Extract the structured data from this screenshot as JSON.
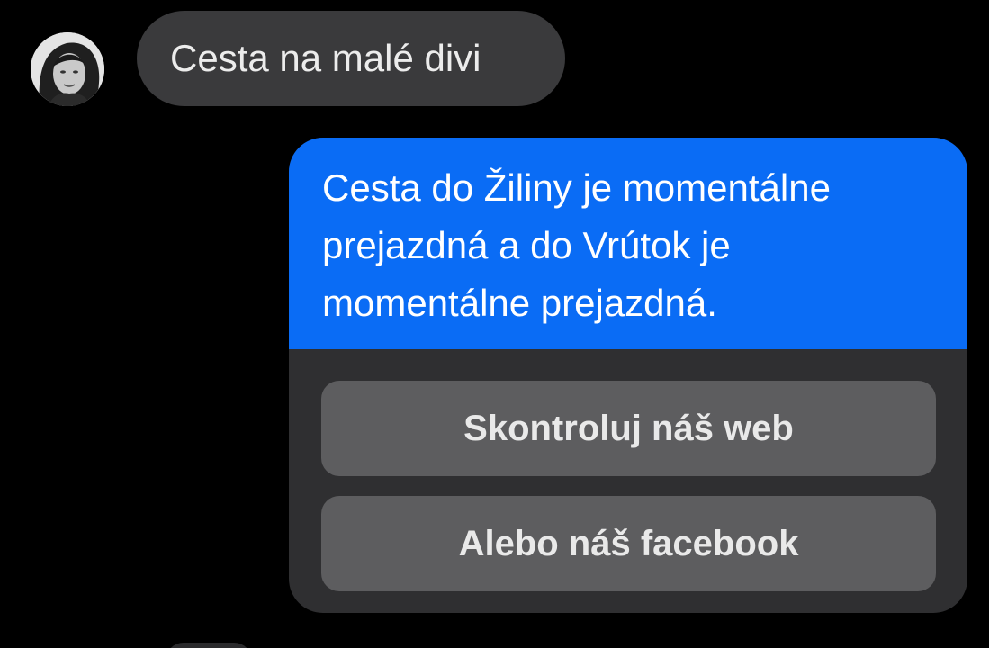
{
  "incoming_message": {
    "text": "Cesta na malé divi"
  },
  "bot_card": {
    "text": "Cesta do Žiliny je momentálne prejazdná a do Vrútok je momentálne prejazdná.",
    "buttons": [
      {
        "label": "Skontroluj náš web"
      },
      {
        "label": "Alebo náš facebook"
      }
    ]
  },
  "colors": {
    "background": "#000000",
    "incoming_bubble": "#3a3a3c",
    "bot_text_bubble": "#0a6cf5",
    "card_background": "#2f2f31",
    "button_background": "#5d5d5f"
  },
  "icons": {
    "avatar": "user-avatar-photo"
  }
}
